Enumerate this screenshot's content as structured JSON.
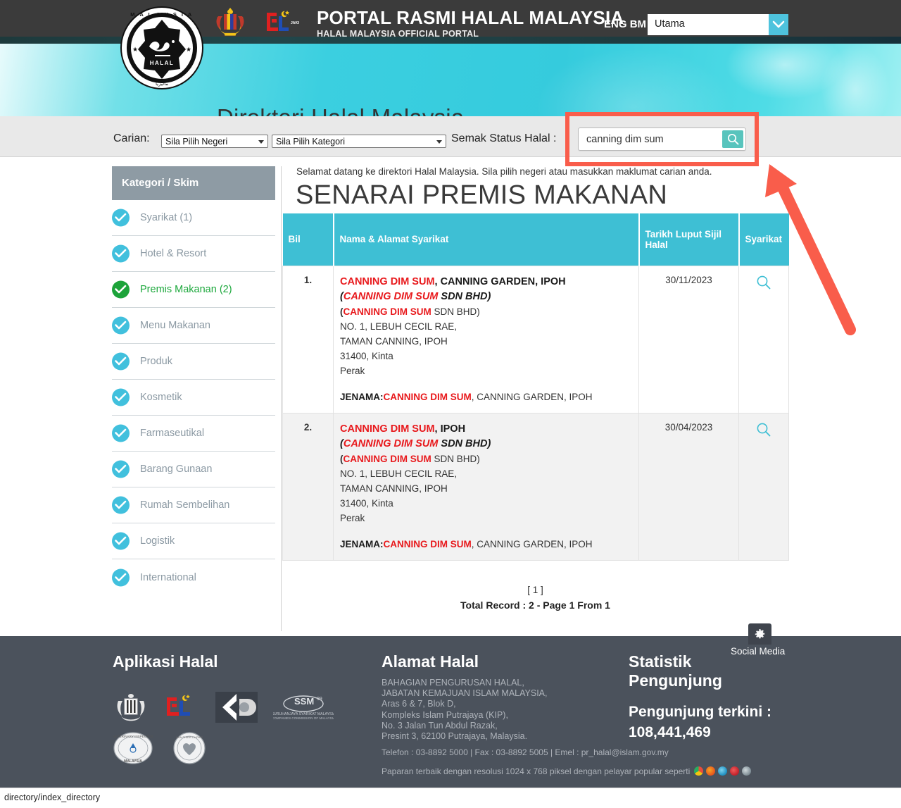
{
  "topbar": {
    "title": "PORTAL RASMI HALAL MALAYSIA",
    "subtitle": "HALAL MALAYSIA OFFICIAL PORTAL",
    "lang_eng": "ENG",
    "lang_bm": "BM",
    "nav_selected": "Utama",
    "bg_color": "#3b3b3b",
    "accent_color": "#4ec3dd"
  },
  "banner": {
    "title": "Direktori Halal Malaysia",
    "seal_text": "HALAL",
    "accent_color": "#3bcfe0"
  },
  "search": {
    "carian_label": "Carian:",
    "state_select": "Sila Pilih Negeri",
    "category_select": "Sila Pilih Kategori",
    "semak_label": "Semak Status Halal :",
    "query_value": "canning dim sum",
    "search_icon": "search-icon",
    "button_color": "#58c4bd",
    "highlight_color": "#f95d4b"
  },
  "annotation": {
    "arrow_color": "#f95d4b",
    "highlight_box_color": "#f95d4b"
  },
  "sidebar": {
    "heading": "Kategori / Skim",
    "items": [
      {
        "label": "Syarikat (1)",
        "active": false
      },
      {
        "label": "Hotel & Resort",
        "active": false
      },
      {
        "label": "Premis Makanan (2)",
        "active": true
      },
      {
        "label": "Menu Makanan",
        "active": false
      },
      {
        "label": "Produk",
        "active": false
      },
      {
        "label": "Kosmetik",
        "active": false
      },
      {
        "label": "Farmaseutikal",
        "active": false
      },
      {
        "label": "Barang Gunaan",
        "active": false
      },
      {
        "label": "Rumah Sembelihan",
        "active": false
      },
      {
        "label": "Logistik",
        "active": false
      },
      {
        "label": "International",
        "active": false
      }
    ],
    "check_color": "#41c0dd",
    "active_color": "#1da33a"
  },
  "main": {
    "welcome": "Selamat datang ke direktori Halal Malaysia. Sila pilih negeri atau masukkan maklumat carian anda.",
    "page_title": "SENARAI PREMIS MAKANAN",
    "columns": [
      "Bil",
      "Nama & Alamat Syarikat",
      "Tarikh Luput Sijil Halal",
      "Syarikat"
    ],
    "header_color": "#3ebfd4",
    "rows": [
      {
        "bil": "1.",
        "name_red": "CANNING DIM SUM",
        "name_rest": ", CANNING GARDEN, IPOH",
        "company_red": "CANNING DIM SUM",
        "company_rest": " SDN BHD)",
        "company_open": "(",
        "legal_red": "CANNING DIM SUM",
        "legal_rest": " SDN BHD)",
        "legal_open": "(",
        "address": [
          "NO. 1, LEBUH CECIL RAE,",
          "TAMAN CANNING, IPOH",
          "31400, Kinta",
          "Perak"
        ],
        "jenama_label": "JENAMA:",
        "jenama_red": "CANNING DIM SUM",
        "jenama_rest": ", CANNING GARDEN, IPOH",
        "expiry": "30/11/2023",
        "action_icon": "magnifier-icon"
      },
      {
        "bil": "2.",
        "name_red": "CANNING DIM SUM",
        "name_rest": ", IPOH",
        "company_red": "CANNING DIM SUM",
        "company_rest": " SDN BHD)",
        "company_open": "(",
        "legal_red": "CANNING DIM SUM",
        "legal_rest": " SDN BHD)",
        "legal_open": "(",
        "address": [
          "NO. 1, LEBUH CECIL RAE,",
          "TAMAN CANNING, IPOH",
          "31400, Kinta",
          "Perak"
        ],
        "jenama_label": "JENAMA:",
        "jenama_red": "CANNING DIM SUM",
        "jenama_rest": ", CANNING GARDEN, IPOH",
        "expiry": "30/04/2023",
        "action_icon": "magnifier-icon"
      }
    ],
    "pager_page": "[ 1 ]",
    "pager_total": "Total Record : 2 - Page 1 From 1",
    "red_color": "#e8191c"
  },
  "footer": {
    "apps_heading": "Aplikasi Halal",
    "address_heading": "Alamat Halal",
    "stats_heading": "Statistik Pengunjung",
    "address_lines": "BAHAGIAN PENGURUSAN HALAL,\nJABATAN KEMAJUAN ISLAM MALAYSIA,\nAras 6 & 7, Blok D,\nKompleks Islam Putrajaya (KIP),\nNo. 3 Jalan Tun Abdul Razak,\nPresint 3, 62100 Putrajaya, Malaysia.",
    "contact": "Telefon : 03-8892 5000 | Fax : 03-8892 5005 | Emel : pr_halal@islam.gov.my",
    "resolution_note": "Paparan terbaik dengan resolusi 1024 x 768 piksel dengan pelayar popular seperti",
    "visitors_label": "Pengunjung terkini :",
    "visitors_count": "108,441,469",
    "social_label": "Social Media",
    "social_icon": "gear-icon",
    "bg_color": "#4b525c"
  },
  "statusbar": {
    "url": "directory/index_directory"
  }
}
